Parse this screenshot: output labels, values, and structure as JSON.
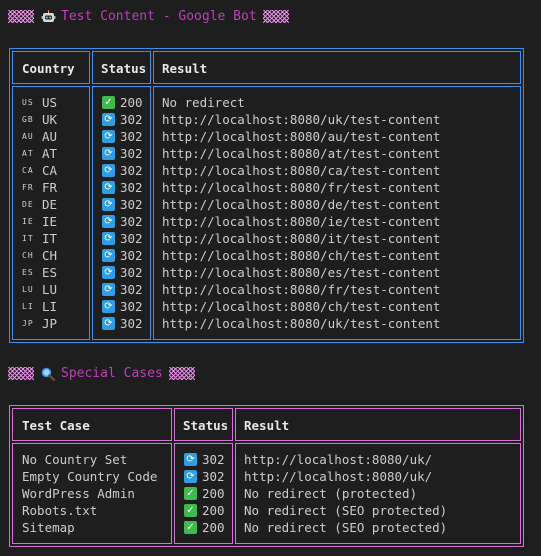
{
  "section1": {
    "title": "Test Content - Google Bot",
    "icon": "robot-icon",
    "headers": {
      "country": "Country",
      "status": "Status",
      "result": "Result"
    },
    "rows": [
      {
        "flag": "US",
        "country": "US",
        "status_icon": "check-icon",
        "status": "200",
        "result": "No redirect"
      },
      {
        "flag": "GB",
        "country": "UK",
        "status_icon": "redirect-icon",
        "status": "302",
        "result": "http://localhost:8080/uk/test-content"
      },
      {
        "flag": "AU",
        "country": "AU",
        "status_icon": "redirect-icon",
        "status": "302",
        "result": "http://localhost:8080/au/test-content"
      },
      {
        "flag": "AT",
        "country": "AT",
        "status_icon": "redirect-icon",
        "status": "302",
        "result": "http://localhost:8080/at/test-content"
      },
      {
        "flag": "CA",
        "country": "CA",
        "status_icon": "redirect-icon",
        "status": "302",
        "result": "http://localhost:8080/ca/test-content"
      },
      {
        "flag": "FR",
        "country": "FR",
        "status_icon": "redirect-icon",
        "status": "302",
        "result": "http://localhost:8080/fr/test-content"
      },
      {
        "flag": "DE",
        "country": "DE",
        "status_icon": "redirect-icon",
        "status": "302",
        "result": "http://localhost:8080/de/test-content"
      },
      {
        "flag": "IE",
        "country": "IE",
        "status_icon": "redirect-icon",
        "status": "302",
        "result": "http://localhost:8080/ie/test-content"
      },
      {
        "flag": "IT",
        "country": "IT",
        "status_icon": "redirect-icon",
        "status": "302",
        "result": "http://localhost:8080/it/test-content"
      },
      {
        "flag": "CH",
        "country": "CH",
        "status_icon": "redirect-icon",
        "status": "302",
        "result": "http://localhost:8080/ch/test-content"
      },
      {
        "flag": "ES",
        "country": "ES",
        "status_icon": "redirect-icon",
        "status": "302",
        "result": "http://localhost:8080/es/test-content"
      },
      {
        "flag": "LU",
        "country": "LU",
        "status_icon": "redirect-icon",
        "status": "302",
        "result": "http://localhost:8080/fr/test-content"
      },
      {
        "flag": "LI",
        "country": "LI",
        "status_icon": "redirect-icon",
        "status": "302",
        "result": "http://localhost:8080/ch/test-content"
      },
      {
        "flag": "JP",
        "country": "JP",
        "status_icon": "redirect-icon",
        "status": "302",
        "result": "http://localhost:8080/uk/test-content"
      }
    ]
  },
  "section2": {
    "title": "Special Cases",
    "icon": "magnifier-icon",
    "headers": {
      "test_case": "Test Case",
      "status": "Status",
      "result": "Result"
    },
    "rows": [
      {
        "test_case": "No Country Set",
        "status_icon": "redirect-icon",
        "status": "302",
        "result": "http://localhost:8080/uk/"
      },
      {
        "test_case": "Empty Country Code",
        "status_icon": "redirect-icon",
        "status": "302",
        "result": "http://localhost:8080/uk/"
      },
      {
        "test_case": "WordPress Admin",
        "status_icon": "check-icon",
        "status": "200",
        "result": "No redirect (protected)"
      },
      {
        "test_case": "Robots.txt",
        "status_icon": "check-icon",
        "status": "200",
        "result": "No redirect (SEO protected)"
      },
      {
        "test_case": "Sitemap",
        "status_icon": "check-icon",
        "status": "200",
        "result": "No redirect (SEO protected)"
      }
    ]
  },
  "colors": {
    "background": "#1e1e1e",
    "heading": "#bc3fbc",
    "table1_border": "#3b8eea",
    "table2_border": "#d670d6",
    "ok": "#3fb950",
    "redirect": "#2f9de0"
  }
}
